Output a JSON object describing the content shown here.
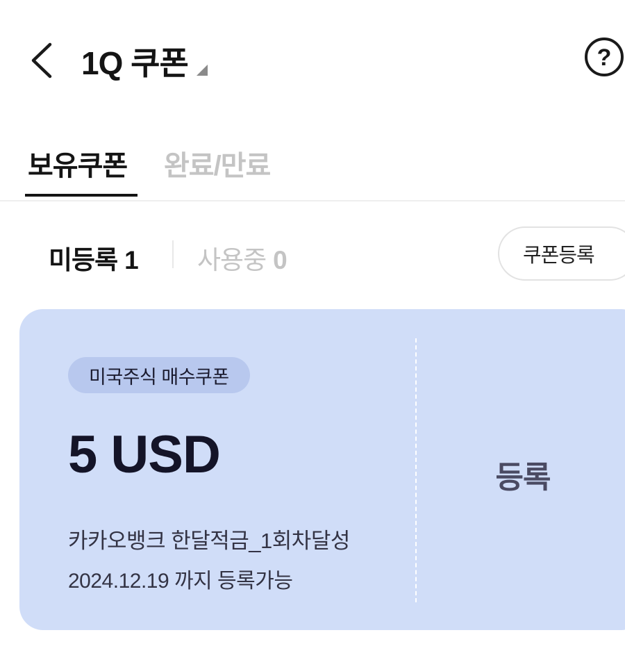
{
  "header": {
    "title": "1Q 쿠폰",
    "back_icon": "chevron-left-icon",
    "help_icon": "question-circle-icon",
    "help_glyph": "?"
  },
  "tabs": [
    {
      "label": "보유쿠폰",
      "active": true
    },
    {
      "label": "완료/만료",
      "active": false
    }
  ],
  "filters": {
    "unregistered": {
      "label": "미등록",
      "count": "1"
    },
    "in_use": {
      "label": "사용중",
      "count": "0"
    },
    "register_button_label": "쿠폰등록"
  },
  "coupon": {
    "badge": "미국주식 매수쿠폰",
    "amount": "5 USD",
    "description": "카카오뱅크 한달적금_1회차달성",
    "expiry": "2024.12.19 까지 등록가능",
    "register_label": "등록"
  },
  "colors": {
    "card_background": "#d0ddf8",
    "badge_background": "#b8c8ee",
    "active_text": "#141414",
    "inactive_text": "#c4c4c4"
  }
}
